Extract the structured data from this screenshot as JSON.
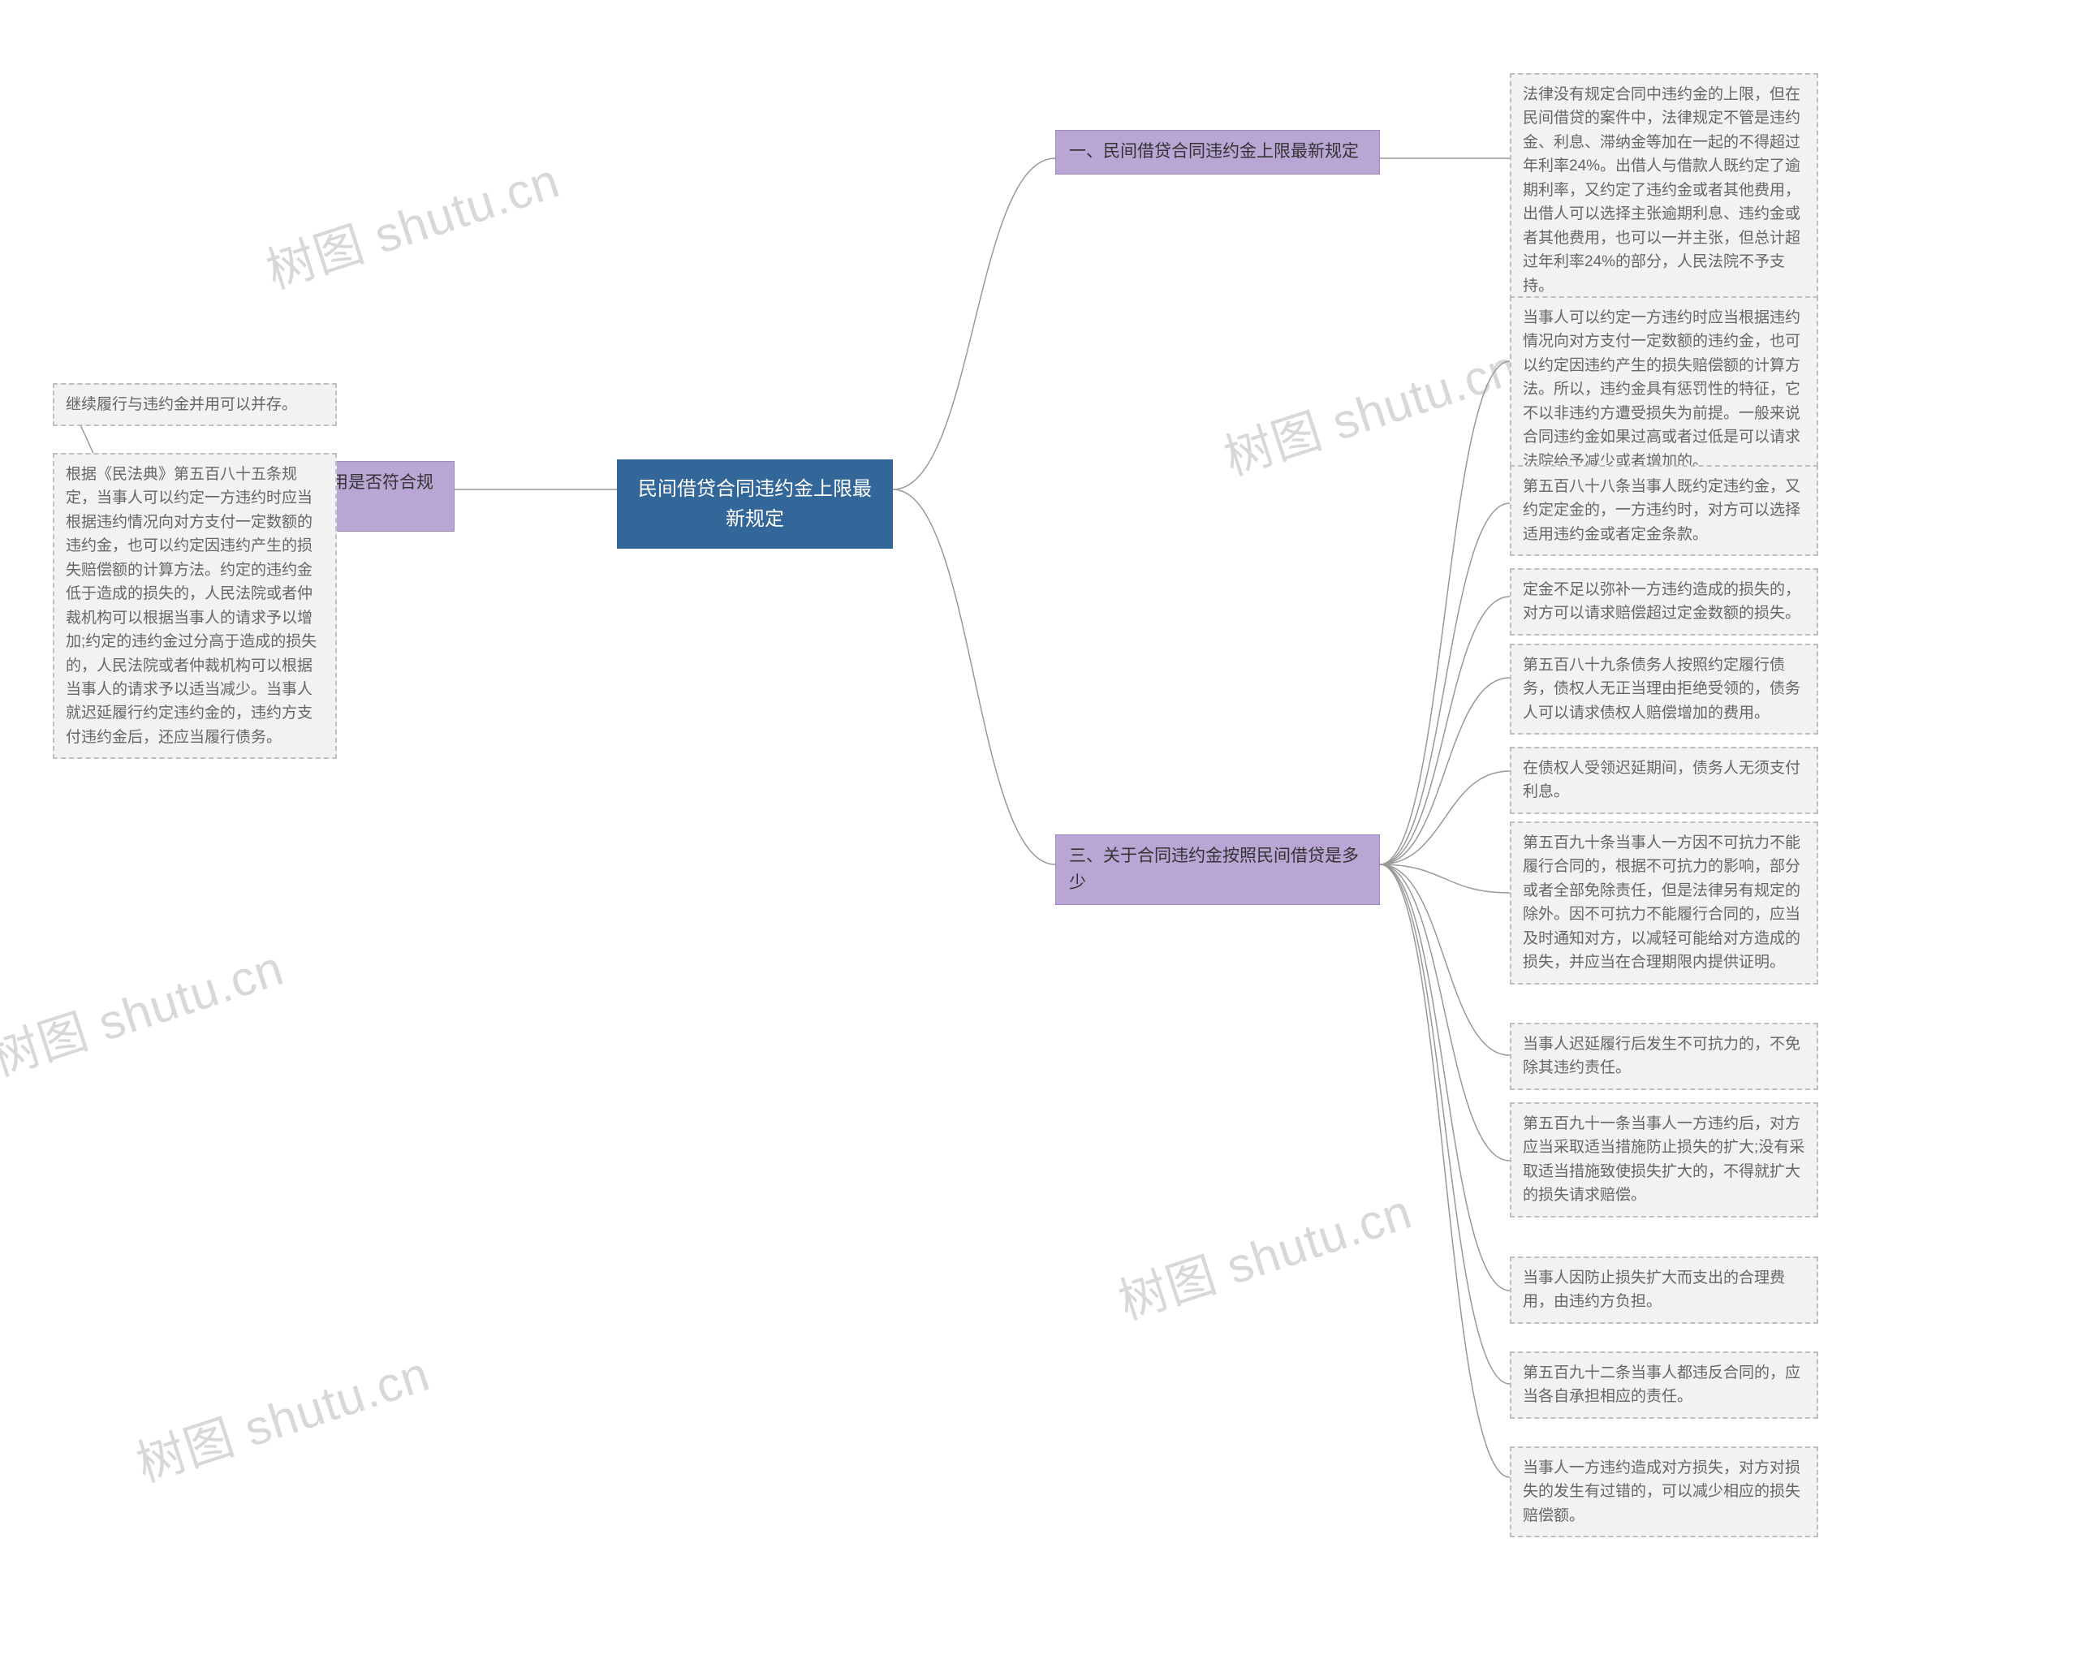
{
  "watermarks": [
    "树图 shutu.cn",
    "树图 shutu.cn",
    "树图 shutu.cn",
    "树图 shutu.cn",
    "树图 shutu.cn"
  ],
  "root": "民间借贷合同违约金上限最新规定",
  "branches": {
    "b1": "一、民间借贷合同违约金上限最新规定",
    "b2": "二、继续履行与违约金并用是否符合规定",
    "b3": "三、关于合同违约金按照民间借贷是多少"
  },
  "leaves": {
    "b1_1": "法律没有规定合同中违约金的上限，但在民间借贷的案件中，法律规定不管是违约金、利息、滞纳金等加在一起的不得超过年利率24%。出借人与借款人既约定了逾期利率，又约定了违约金或者其他费用，出借人可以选择主张逾期利息、违约金或者其他费用，也可以一并主张，但总计超过年利率24%的部分，人民法院不予支持。",
    "b2_1": "继续履行与违约金并用可以并存。",
    "b2_2": "根据《民法典》第五百八十五条规定，当事人可以约定一方违约时应当根据违约情况向对方支付一定数额的违约金，也可以约定因违约产生的损失赔偿额的计算方法。约定的违约金低于造成的损失的，人民法院或者仲裁机构可以根据当事人的请求予以增加;约定的违约金过分高于造成的损失的，人民法院或者仲裁机构可以根据当事人的请求予以适当减少。当事人就迟延履行约定违约金的，违约方支付违约金后，还应当履行债务。",
    "b3_1": "当事人可以约定一方违约时应当根据违约情况向对方支付一定数额的违约金，也可以约定因违约产生的损失赔偿额的计算方法。所以，违约金具有惩罚性的特征，它不以非违约方遭受损失为前提。一般来说合同违约金如果过高或者过低是可以请求法院给予减少或者增加的。",
    "b3_2": "第五百八十八条当事人既约定违约金，又约定定金的，一方违约时，对方可以选择适用违约金或者定金条款。",
    "b3_3": "定金不足以弥补一方违约造成的损失的，对方可以请求赔偿超过定金数额的损失。",
    "b3_4": "第五百八十九条债务人按照约定履行债务，债权人无正当理由拒绝受领的，债务人可以请求债权人赔偿增加的费用。",
    "b3_5": "在债权人受领迟延期间，债务人无须支付利息。",
    "b3_6": "第五百九十条当事人一方因不可抗力不能履行合同的，根据不可抗力的影响，部分或者全部免除责任，但是法律另有规定的除外。因不可抗力不能履行合同的，应当及时通知对方，以减轻可能给对方造成的损失，并应当在合理期限内提供证明。",
    "b3_7": "当事人迟延履行后发生不可抗力的，不免除其违约责任。",
    "b3_8": "第五百九十一条当事人一方违约后，对方应当采取适当措施防止损失的扩大;没有采取适当措施致使损失扩大的，不得就扩大的损失请求赔偿。",
    "b3_9": "当事人因防止损失扩大而支出的合理费用，由违约方负担。",
    "b3_10": "第五百九十二条当事人都违反合同的，应当各自承担相应的责任。",
    "b3_11": "当事人一方违约造成对方损失，对方对损失的发生有过错的，可以减少相应的损失赔偿额。"
  }
}
